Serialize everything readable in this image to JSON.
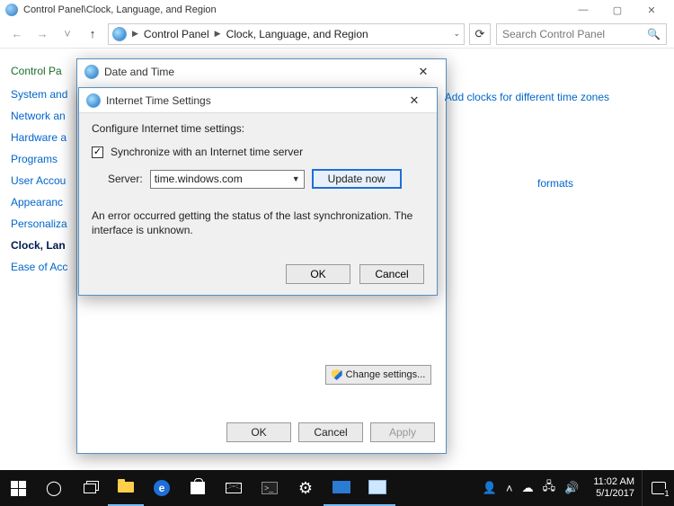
{
  "window": {
    "title": "Control Panel\\Clock, Language, and Region",
    "breadcrumbs": [
      "Control Panel",
      "Clock, Language, and Region"
    ],
    "search_placeholder": "Search Control Panel"
  },
  "sidebar": {
    "heading": "Control Pa",
    "items": [
      {
        "label": "System and"
      },
      {
        "label": "Network an"
      },
      {
        "label": "Hardware a"
      },
      {
        "label": "Programs"
      },
      {
        "label": "User Accou"
      },
      {
        "label": "Appearanc"
      },
      {
        "label": "Personaliza"
      },
      {
        "label": "Clock, Lan",
        "active": true
      },
      {
        "label": "Ease of Acc"
      }
    ]
  },
  "main_links": {
    "add_clocks": "Add clocks for different time zones",
    "formats": "formats"
  },
  "dlg_datetime": {
    "title": "Date and Time",
    "change_settings": "Change settings...",
    "ok": "OK",
    "cancel": "Cancel",
    "apply": "Apply"
  },
  "dlg_internet": {
    "title": "Internet Time Settings",
    "configure": "Configure Internet time settings:",
    "sync_label": "Synchronize with an Internet time server",
    "server_label": "Server:",
    "server_value": "time.windows.com",
    "update_now": "Update now",
    "error": "An error occurred getting the status of the last synchronization.  The interface is unknown.",
    "ok": "OK",
    "cancel": "Cancel"
  },
  "taskbar": {
    "time": "11:02 AM",
    "date": "5/1/2017",
    "notif_count": "1"
  }
}
